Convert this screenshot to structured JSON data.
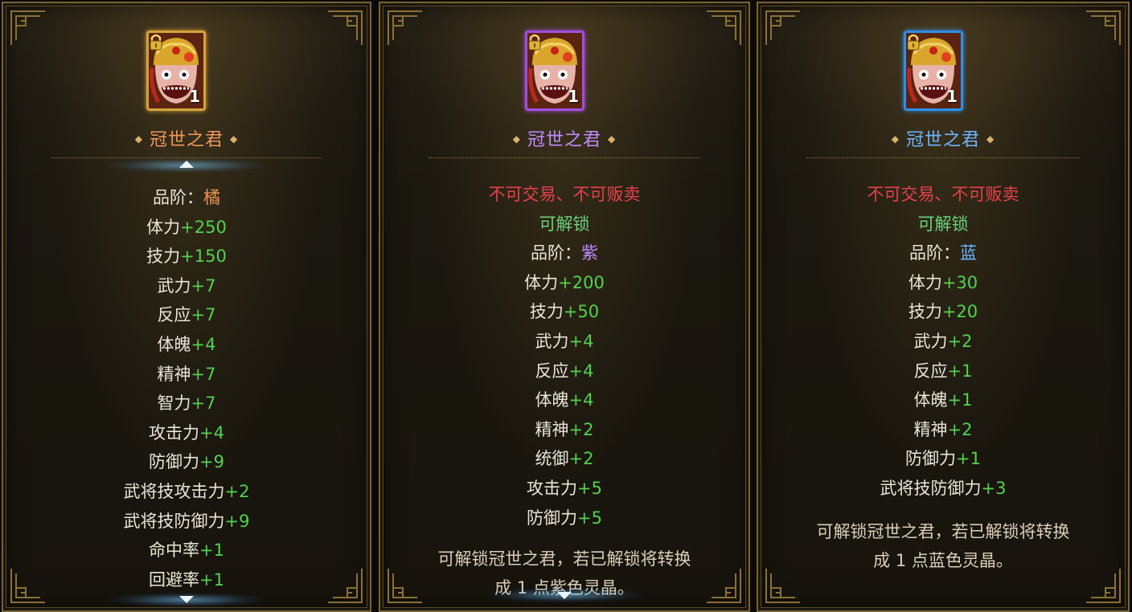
{
  "panels": [
    {
      "name": "冠世之君",
      "count": "1",
      "name_color": "#f0965a",
      "frame_color": "#d6a23a",
      "tradable_text": "",
      "unlock_text": "",
      "grade_label": "品阶：",
      "grade_value": "橘",
      "grade_color": "#f0965a",
      "stats": [
        {
          "label": "体力",
          "value": "+250"
        },
        {
          "label": "技力",
          "value": "+150"
        },
        {
          "label": "武力",
          "value": "+7"
        },
        {
          "label": "反应",
          "value": "+7"
        },
        {
          "label": "体魄",
          "value": "+4"
        },
        {
          "label": "精神",
          "value": "+7"
        },
        {
          "label": "智力",
          "value": "+7"
        },
        {
          "label": "攻击力",
          "value": "+4"
        },
        {
          "label": "防御力",
          "value": "+9"
        },
        {
          "label": "武将技攻击力",
          "value": "+2"
        },
        {
          "label": "武将技防御力",
          "value": "+9"
        },
        {
          "label": "命中率",
          "value": "+1"
        },
        {
          "label": "回避率",
          "value": "+1"
        }
      ],
      "description": []
    },
    {
      "name": "冠世之君",
      "count": "1",
      "name_color": "#c08cff",
      "frame_color": "#a24de0",
      "tradable_text": "不可交易、不可贩卖",
      "unlock_text": "可解锁",
      "grade_label": "品阶：",
      "grade_value": "紫",
      "grade_color": "#c08cff",
      "stats": [
        {
          "label": "体力",
          "value": "+200"
        },
        {
          "label": "技力",
          "value": "+50"
        },
        {
          "label": "武力",
          "value": "+4"
        },
        {
          "label": "反应",
          "value": "+4"
        },
        {
          "label": "体魄",
          "value": "+4"
        },
        {
          "label": "精神",
          "value": "+2"
        },
        {
          "label": "统御",
          "value": "+2"
        },
        {
          "label": "攻击力",
          "value": "+5"
        },
        {
          "label": "防御力",
          "value": "+5"
        }
      ],
      "description": [
        "可解锁冠世之君，若已解锁将转换",
        "成 1 点紫色灵晶。"
      ]
    },
    {
      "name": "冠世之君",
      "count": "1",
      "name_color": "#6cb6ff",
      "frame_color": "#2e8fe6",
      "tradable_text": "不可交易、不可贩卖",
      "unlock_text": "可解锁",
      "grade_label": "品阶：",
      "grade_value": "蓝",
      "grade_color": "#6cb6ff",
      "stats": [
        {
          "label": "体力",
          "value": "+30"
        },
        {
          "label": "技力",
          "value": "+20"
        },
        {
          "label": "武力",
          "value": "+2"
        },
        {
          "label": "反应",
          "value": "+1"
        },
        {
          "label": "体魄",
          "value": "+1"
        },
        {
          "label": "精神",
          "value": "+2"
        },
        {
          "label": "防御力",
          "value": "+1"
        },
        {
          "label": "武将技防御力",
          "value": "+3"
        }
      ],
      "description": [
        "可解锁冠世之君，若已解锁将转换",
        "成 1 点蓝色灵晶。"
      ]
    }
  ],
  "colors": {
    "stat_value": "#52d24e",
    "warning_red": "#e8404a",
    "unlock_green": "#6ad27a",
    "frame_gold": "#7a6332"
  },
  "icons": {
    "item": "mask-icon",
    "lock": "lock-icon",
    "scroll_up": "arrow-up-icon",
    "scroll_down": "arrow-down-icon"
  }
}
